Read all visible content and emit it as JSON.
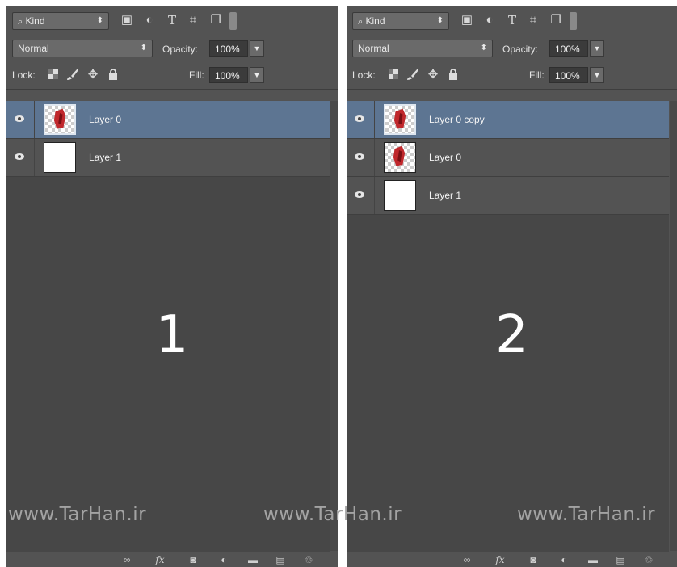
{
  "panels": [
    {
      "filter": {
        "kind_label": "Kind",
        "icons": [
          "image-icon",
          "adjustment-icon",
          "type-icon",
          "shape-icon",
          "smart-object-icon",
          "filter-toggle-icon"
        ]
      },
      "blend_mode": "Normal",
      "opacity_label": "Opacity:",
      "opacity_value": "100%",
      "lock_label": "Lock:",
      "fill_label": "Fill:",
      "fill_value": "100%",
      "layers": [
        {
          "name": "Layer 0",
          "thumbnail": "transparent-with-red-object",
          "selected": true
        },
        {
          "name": "Layer 1",
          "thumbnail": "white",
          "selected": false
        }
      ],
      "big_number": "1"
    },
    {
      "filter": {
        "kind_label": "Kind",
        "icons": [
          "image-icon",
          "adjustment-icon",
          "type-icon",
          "shape-icon",
          "smart-object-icon",
          "filter-toggle-icon"
        ]
      },
      "blend_mode": "Normal",
      "opacity_label": "Opacity:",
      "opacity_value": "100%",
      "lock_label": "Lock:",
      "fill_label": "Fill:",
      "fill_value": "100%",
      "layers": [
        {
          "name": "Layer 0 copy",
          "thumbnail": "transparent-with-red-object",
          "selected": true
        },
        {
          "name": "Layer 0",
          "thumbnail": "transparent-with-red-object",
          "selected": false
        },
        {
          "name": "Layer 1",
          "thumbnail": "white",
          "selected": false
        }
      ],
      "big_number": "2"
    }
  ],
  "watermarks": [
    "www.TarHan.ir",
    "www.TarHan.ir",
    "www.TarHan.ir"
  ],
  "bottom_icons": [
    "link-icon",
    "fx-icon",
    "mask-icon",
    "adjustment-layer-icon",
    "group-folder-icon",
    "new-layer-icon",
    "trash-icon"
  ],
  "colors": {
    "panel_bg": "#535353",
    "selected_row": "#5d7592",
    "text": "#f4f4f4"
  }
}
